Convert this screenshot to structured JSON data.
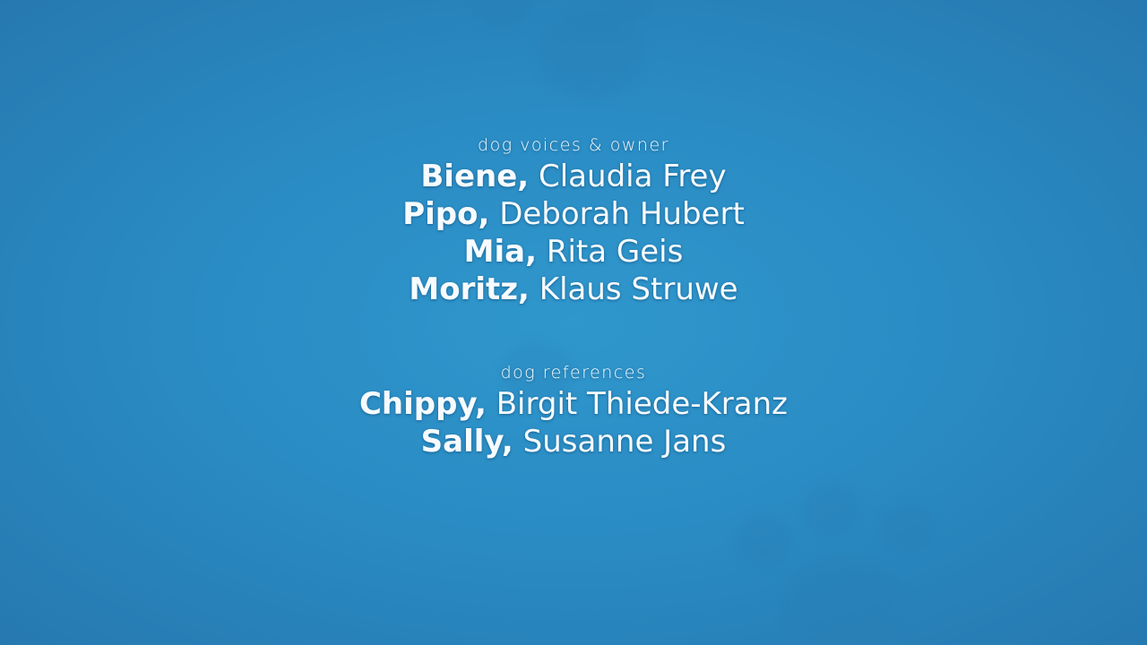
{
  "voices": {
    "heading": "dog voices & owner",
    "credits": [
      {
        "dog": "Biene,",
        "person": "Claudia Frey"
      },
      {
        "dog": "Pipo,",
        "person": "Deborah Hubert"
      },
      {
        "dog": "Mia,",
        "person": "Rita Geis"
      },
      {
        "dog": "Moritz,",
        "person": "Klaus Struwe"
      }
    ]
  },
  "references": {
    "heading": "dog references",
    "credits": [
      {
        "dog": "Chippy,",
        "person": "Birgit Thiede-Kranz"
      },
      {
        "dog": "Sally,",
        "person": "Susanne Jans"
      }
    ]
  },
  "colors": {
    "background": "#2a8cc4",
    "text": "#f7fbfe"
  },
  "decorations": [
    "paw-print-icon",
    "paw-print-icon",
    "paw-print-icon"
  ]
}
